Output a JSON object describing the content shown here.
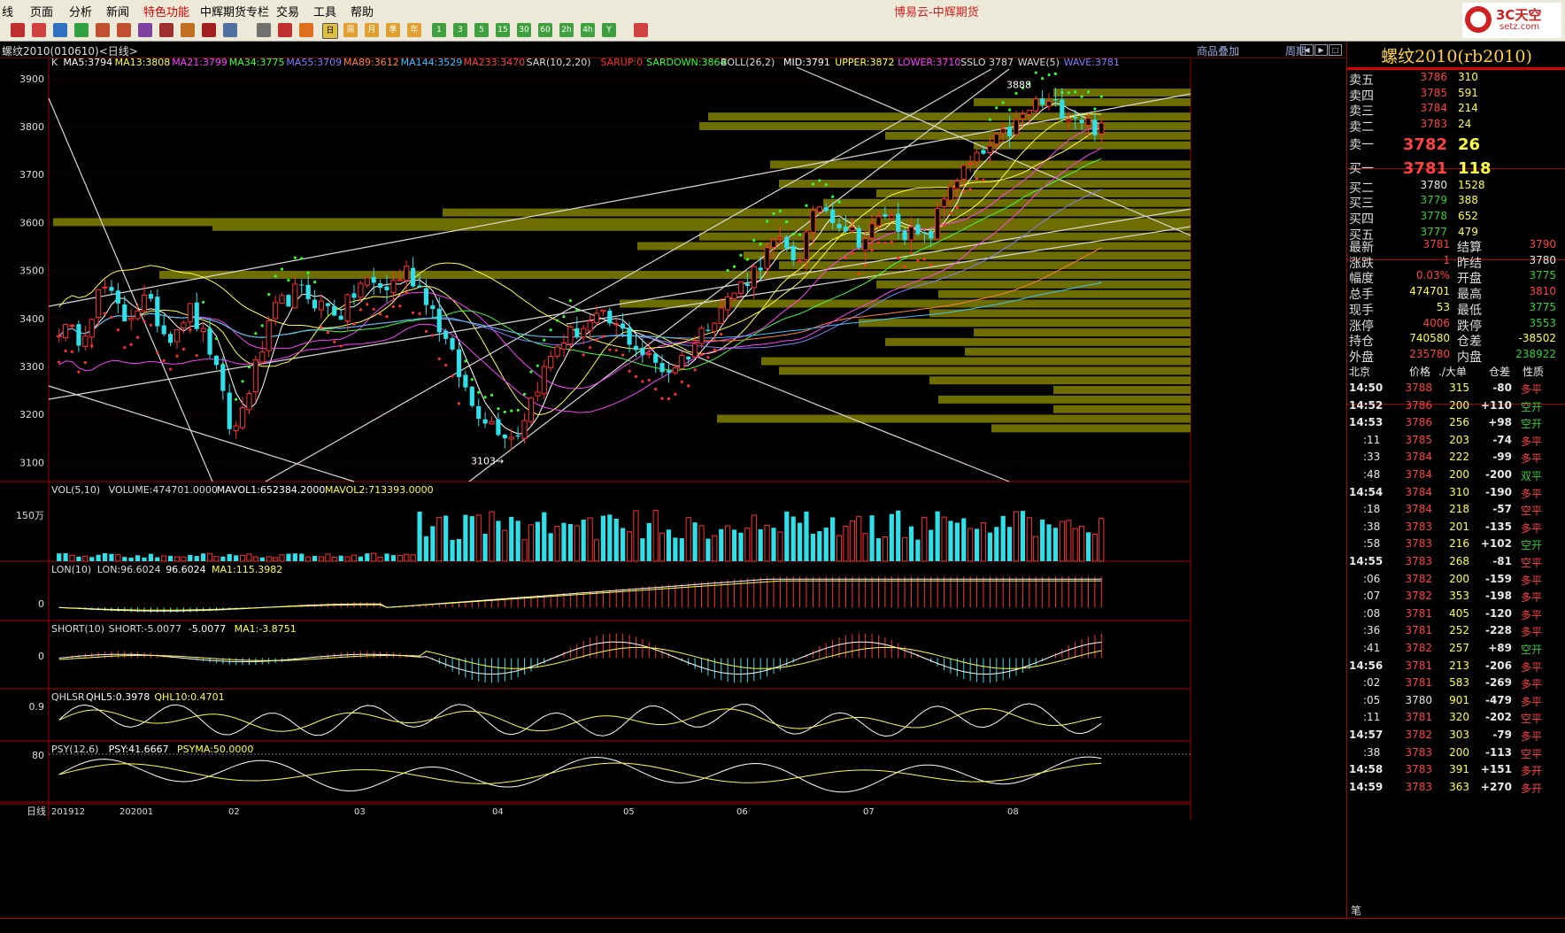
{
  "menu": {
    "items": [
      "线",
      "页面",
      "分析",
      "新闻",
      "特色功能",
      "中辉期货专栏",
      "交易",
      "工具",
      "帮助"
    ],
    "window_title": "博易云-中辉期货"
  },
  "toolbar": {
    "period_buttons": [
      "日",
      "周",
      "月",
      "季",
      "年",
      "1",
      "3",
      "5",
      "15",
      "30",
      "60",
      "2h",
      "4h",
      "Y"
    ]
  },
  "logo": {
    "text": "3C天空",
    "sub": "setz.com"
  },
  "chart_header": {
    "title": "螺纹2010(010610)<日线>",
    "overlay_link": "商品叠加",
    "period_link": "周期"
  },
  "colors": {
    "up": "#ff3030",
    "down": "#30e0e8",
    "price_bg": "#000000",
    "band": "#6e6e00",
    "yellow": "#ffff00",
    "red_border": "#aa0000"
  },
  "main_indicator": {
    "items": [
      {
        "text": "K",
        "color": "#dddddd"
      },
      {
        "text": "MA5:3794",
        "color": "#ffffff"
      },
      {
        "text": "MA13:3808",
        "color": "#ffff40"
      },
      {
        "text": "MA21:3799",
        "color": "#ff40ff"
      },
      {
        "text": "MA34:3775",
        "color": "#40ff40"
      },
      {
        "text": "MA55:3709",
        "color": "#8080ff"
      },
      {
        "text": "MA89:3612",
        "color": "#ff8040"
      },
      {
        "text": "MA144:3529",
        "color": "#40c0ff"
      },
      {
        "text": "MA233:3470",
        "color": "#ff4040"
      },
      {
        "text": "SAR(10,2,20)",
        "color": "#dddddd"
      },
      {
        "text": "SARUP:0",
        "color": "#ff3030"
      },
      {
        "text": "SARDOWN:3864",
        "color": "#30ff30"
      },
      {
        "text": "BOLL(26,2)",
        "color": "#dddddd"
      },
      {
        "text": "MID:3791",
        "color": "#ffffff"
      },
      {
        "text": "UPPER:3872",
        "color": "#ffff40"
      },
      {
        "text": "LOWER:3710",
        "color": "#ff40ff"
      },
      {
        "text": "SSLO 3787",
        "color": "#dddddd"
      },
      {
        "text": "WAVE(5)",
        "color": "#dddddd"
      },
      {
        "text": "WAVE:3781",
        "color": "#8080ff"
      }
    ],
    "y_ticks": [
      "3900",
      "3800",
      "3700",
      "3600",
      "3500",
      "3400",
      "3300",
      "3200",
      "3100"
    ],
    "high_label": "3888",
    "low_label": "3103"
  },
  "vol_indicator": {
    "items": [
      {
        "text": "VOL(5,10)",
        "color": "#dddddd"
      },
      {
        "text": "VOLUME:474701.0000",
        "color": "#dddddd"
      },
      {
        "text": "MAVOL1:652384.2000",
        "color": "#ffffff"
      },
      {
        "text": "MAVOL2:713393.0000",
        "color": "#ffff40"
      }
    ],
    "y_label": "150万"
  },
  "lon_indicator": {
    "items": [
      {
        "text": "LON(10)",
        "color": "#dddddd"
      },
      {
        "text": "LON:96.6024",
        "color": "#dddddd"
      },
      {
        "text": "96.6024",
        "color": "#ffffff"
      },
      {
        "text": "MA1:115.3982",
        "color": "#ffff40"
      }
    ],
    "y_label": "0"
  },
  "short_indicator": {
    "items": [
      {
        "text": "SHORT(10)",
        "color": "#dddddd"
      },
      {
        "text": "SHORT:-5.0077",
        "color": "#dddddd"
      },
      {
        "text": "-5.0077",
        "color": "#ffffff"
      },
      {
        "text": "MA1:-3.8751",
        "color": "#ffff40"
      }
    ],
    "y_label": "0"
  },
  "qhlsr_indicator": {
    "items": [
      {
        "text": "QHLSR",
        "color": "#dddddd"
      },
      {
        "text": "QHL5:0.3978",
        "color": "#ffffff"
      },
      {
        "text": "QHL10:0.4701",
        "color": "#ffff40"
      }
    ],
    "y_label": "0.9"
  },
  "psy_indicator": {
    "items": [
      {
        "text": "PSY(12,6)",
        "color": "#dddddd"
      },
      {
        "text": "PSY:41.6667",
        "color": "#ffffff"
      },
      {
        "text": "PSYMA:50.0000",
        "color": "#ffff40"
      }
    ],
    "y_label": "80"
  },
  "x_axis": {
    "label": "日线",
    "ticks": [
      "201912",
      "202001",
      "02",
      "03",
      "04",
      "05",
      "06",
      "07",
      "08"
    ]
  },
  "quote": {
    "title": "螺纹2010(rb2010)",
    "asks": [
      {
        "label": "卖五",
        "price": "3786",
        "vol": "310"
      },
      {
        "label": "卖四",
        "price": "3785",
        "vol": "591"
      },
      {
        "label": "卖三",
        "price": "3784",
        "vol": "214"
      },
      {
        "label": "卖二",
        "price": "3783",
        "vol": "24"
      },
      {
        "label": "卖一",
        "price": "3782",
        "vol": "26"
      }
    ],
    "bids": [
      {
        "label": "买一",
        "price": "3781",
        "vol": "118"
      },
      {
        "label": "买二",
        "price": "3780",
        "vol": "1528"
      },
      {
        "label": "买三",
        "price": "3779",
        "vol": "388"
      },
      {
        "label": "买四",
        "price": "3778",
        "vol": "652"
      },
      {
        "label": "买五",
        "price": "3777",
        "vol": "479"
      }
    ],
    "stats": [
      {
        "l1": "最新",
        "v1": "3781",
        "c1": "up",
        "l2": "结算",
        "v2": "3790",
        "c2": "up"
      },
      {
        "l1": "涨跌",
        "v1": "1",
        "c1": "up",
        "l2": "昨结",
        "v2": "3780",
        "c2": "wh"
      },
      {
        "l1": "幅度",
        "v1": "0.03%",
        "c1": "up",
        "l2": "开盘",
        "v2": "3775",
        "c2": "dn"
      },
      {
        "l1": "总手",
        "v1": "474701",
        "c1": "yl",
        "l2": "最高",
        "v2": "3810",
        "c2": "up"
      },
      {
        "l1": "现手",
        "v1": "53",
        "c1": "yl",
        "l2": "最低",
        "v2": "3775",
        "c2": "dn"
      },
      {
        "l1": "涨停",
        "v1": "4006",
        "c1": "up",
        "l2": "跌停",
        "v2": "3553",
        "c2": "dn"
      },
      {
        "l1": "持仓",
        "v1": "740580",
        "c1": "yl",
        "l2": "仓差",
        "v2": "-38502",
        "c2": "yl"
      },
      {
        "l1": "外盘",
        "v1": "235780",
        "c1": "up",
        "l2": "内盘",
        "v2": "238922",
        "c2": "dn"
      }
    ],
    "tick_header": [
      "北京",
      "价格",
      "./大单",
      "仓差",
      "性质"
    ],
    "ticks": [
      {
        "t": "14:50",
        "p": "3788",
        "pc": "up",
        "v": "315",
        "vc": "yl",
        "d": "-80",
        "dc": "wh",
        "n": "多平",
        "nc": "up"
      },
      {
        "t": "14:52",
        "p": "3786",
        "pc": "up",
        "v": "200",
        "vc": "yl",
        "d": "+110",
        "dc": "wh",
        "n": "空开",
        "nc": "dn"
      },
      {
        "t": "14:53",
        "p": "3786",
        "pc": "up",
        "v": "256",
        "vc": "yl",
        "d": "+98",
        "dc": "wh",
        "n": "空开",
        "nc": "dn"
      },
      {
        "t": ":11",
        "p": "3785",
        "pc": "up",
        "v": "203",
        "vc": "yl",
        "d": "-74",
        "dc": "wh",
        "n": "多平",
        "nc": "up"
      },
      {
        "t": ":33",
        "p": "3784",
        "pc": "up",
        "v": "222",
        "vc": "yl",
        "d": "-99",
        "dc": "wh",
        "n": "多平",
        "nc": "up"
      },
      {
        "t": ":48",
        "p": "3784",
        "pc": "up",
        "v": "200",
        "vc": "yl",
        "d": "-200",
        "dc": "wh",
        "n": "双平",
        "nc": "dn"
      },
      {
        "t": "14:54",
        "p": "3784",
        "pc": "up",
        "v": "310",
        "vc": "yl",
        "d": "-190",
        "dc": "wh",
        "n": "多平",
        "nc": "up"
      },
      {
        "t": ":18",
        "p": "3784",
        "pc": "up",
        "v": "218",
        "vc": "yl",
        "d": "-57",
        "dc": "wh",
        "n": "空平",
        "nc": "up"
      },
      {
        "t": ":38",
        "p": "3783",
        "pc": "up",
        "v": "201",
        "vc": "yl",
        "d": "-135",
        "dc": "wh",
        "n": "多平",
        "nc": "up"
      },
      {
        "t": ":58",
        "p": "3783",
        "pc": "up",
        "v": "216",
        "vc": "yl",
        "d": "+102",
        "dc": "wh",
        "n": "空开",
        "nc": "dn"
      },
      {
        "t": "14:55",
        "p": "3783",
        "pc": "up",
        "v": "268",
        "vc": "yl",
        "d": "-81",
        "dc": "wh",
        "n": "空平",
        "nc": "up"
      },
      {
        "t": ":06",
        "p": "3782",
        "pc": "up",
        "v": "200",
        "vc": "yl",
        "d": "-159",
        "dc": "wh",
        "n": "多平",
        "nc": "up"
      },
      {
        "t": ":07",
        "p": "3782",
        "pc": "up",
        "v": "353",
        "vc": "yl",
        "d": "-198",
        "dc": "wh",
        "n": "多平",
        "nc": "up"
      },
      {
        "t": ":08",
        "p": "3781",
        "pc": "up",
        "v": "405",
        "vc": "yl",
        "d": "-120",
        "dc": "wh",
        "n": "多平",
        "nc": "up"
      },
      {
        "t": ":36",
        "p": "3781",
        "pc": "up",
        "v": "252",
        "vc": "yl",
        "d": "-228",
        "dc": "wh",
        "n": "多平",
        "nc": "up"
      },
      {
        "t": ":41",
        "p": "3782",
        "pc": "up",
        "v": "257",
        "vc": "yl",
        "d": "+89",
        "dc": "wh",
        "n": "空开",
        "nc": "dn"
      },
      {
        "t": "14:56",
        "p": "3781",
        "pc": "up",
        "v": "213",
        "vc": "yl",
        "d": "-206",
        "dc": "wh",
        "n": "多平",
        "nc": "up"
      },
      {
        "t": ":02",
        "p": "3781",
        "pc": "up",
        "v": "583",
        "vc": "yl",
        "d": "-269",
        "dc": "wh",
        "n": "多平",
        "nc": "up"
      },
      {
        "t": ":05",
        "p": "3780",
        "pc": "wh",
        "v": "901",
        "vc": "yl",
        "d": "-479",
        "dc": "wh",
        "n": "多平",
        "nc": "up"
      },
      {
        "t": ":11",
        "p": "3781",
        "pc": "up",
        "v": "320",
        "vc": "yl",
        "d": "-202",
        "dc": "wh",
        "n": "空平",
        "nc": "up"
      },
      {
        "t": "14:57",
        "p": "3782",
        "pc": "up",
        "v": "303",
        "vc": "yl",
        "d": "-79",
        "dc": "wh",
        "n": "多平",
        "nc": "up"
      },
      {
        "t": ":38",
        "p": "3783",
        "pc": "up",
        "v": "200",
        "vc": "yl",
        "d": "-113",
        "dc": "wh",
        "n": "空平",
        "nc": "up"
      },
      {
        "t": "14:58",
        "p": "3783",
        "pc": "up",
        "v": "391",
        "vc": "yl",
        "d": "+151",
        "dc": "wh",
        "n": "多开",
        "nc": "up"
      },
      {
        "t": "14:59",
        "p": "3783",
        "pc": "up",
        "v": "363",
        "vc": "yl",
        "d": "+270",
        "dc": "wh",
        "n": "多开",
        "nc": "up"
      }
    ],
    "trade_tab": "笔"
  },
  "chart_data": {
    "type": "candlestick",
    "y_range": [
      3060,
      3920
    ],
    "high": 3888,
    "low": 3103,
    "anchors": [
      3380,
      3360,
      3470,
      3400,
      3440,
      3360,
      3420,
      3330,
      3150,
      3290,
      3420,
      3460,
      3430,
      3410,
      3480,
      3460,
      3500,
      3440,
      3330,
      3220,
      3180,
      3150,
      3260,
      3350,
      3380,
      3400,
      3370,
      3320,
      3290,
      3330,
      3400,
      3450,
      3500,
      3560,
      3520,
      3640,
      3600,
      3560,
      3620,
      3580,
      3560,
      3680,
      3720,
      3760,
      3800,
      3850,
      3840,
      3820,
      3790
    ]
  }
}
